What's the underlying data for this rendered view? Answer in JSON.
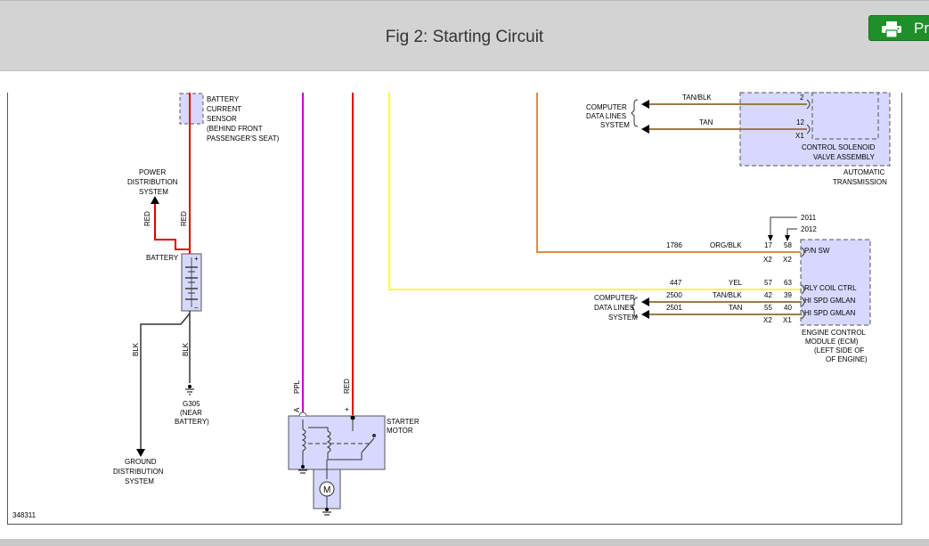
{
  "header": {
    "title": "Fig 2: Starting Circuit",
    "print_label": "Print",
    "print_icon": "printer-icon"
  },
  "colors": {
    "header_bg": "#d3d3d3",
    "print_button": "#1f8f2a",
    "wire_red": "#e00000",
    "wire_ppl": "#cc00cc",
    "wire_yel": "#ffff33",
    "wire_org": "#e08a40",
    "wire_tan": "#9a7a4a",
    "wire_blk": "#333333",
    "component_fill": "#d8d8ff"
  },
  "diagram": {
    "battery_sensor": [
      "BATTERY",
      "CURRENT",
      "SENSOR",
      "(BEHIND FRONT",
      "PASSENGER'S SEAT)"
    ],
    "power_dist": [
      "POWER",
      "DISTRIBUTION",
      "SYSTEM"
    ],
    "wire_red": "RED",
    "wire_blk": "BLK",
    "wire_ppl": "PPL",
    "battery_label": "BATTERY",
    "battery_plus": "+",
    "battery_minus": "–",
    "ground_g305": [
      "G305",
      "(NEAR",
      "BATTERY)"
    ],
    "ground_dist": [
      "GROUND",
      "DISTRIBUTION",
      "SYSTEM"
    ],
    "starter_terminal_a": "A",
    "starter_terminal_plus": "+",
    "starter_label": [
      "STARTER",
      "MOTOR"
    ],
    "motor_symbol": "M",
    "figure_id": "348311",
    "computer_lines_top": [
      "COMPUTER",
      "DATA LINES",
      "SYSTEM"
    ],
    "computer_lines_bottom": [
      "COMPUTER",
      "DATA LINES",
      "SYSTEM"
    ],
    "trans_tanblk": "TAN/BLK",
    "trans_tan": "TAN",
    "trans_pin_2": "2",
    "trans_pin_12": "12",
    "trans_x1": "X1",
    "control_solenoid": [
      "CONTROL SOLENOID",
      "VALVE ASSEMBLY"
    ],
    "auto_trans": [
      "AUTOMATIC",
      "TRANSMISSION"
    ],
    "year_2011": "2011",
    "year_2012": "2012",
    "ecm_rows": [
      {
        "circuit": "1786",
        "color": "ORG/BLK",
        "pin_a": "17",
        "pin_b": "58",
        "function": "P/N SW"
      },
      {
        "circuit": "447",
        "color": "YEL",
        "pin_a": "57",
        "pin_b": "63",
        "function": "RLY COIL CTRL"
      },
      {
        "circuit": "2500",
        "color": "TAN/BLK",
        "pin_a": "42",
        "pin_b": "39",
        "function": "HI SPD GMLAN"
      },
      {
        "circuit": "2501",
        "color": "TAN",
        "pin_a": "55",
        "pin_b": "40",
        "function": "HI SPD GMLAN"
      }
    ],
    "conn_x2": "X2",
    "conn_x1": "X1",
    "ecm_label": [
      "ENGINE CONTROL",
      "MODULE (ECM)",
      "(LEFT SIDE OF",
      "OF ENGINE)"
    ]
  }
}
